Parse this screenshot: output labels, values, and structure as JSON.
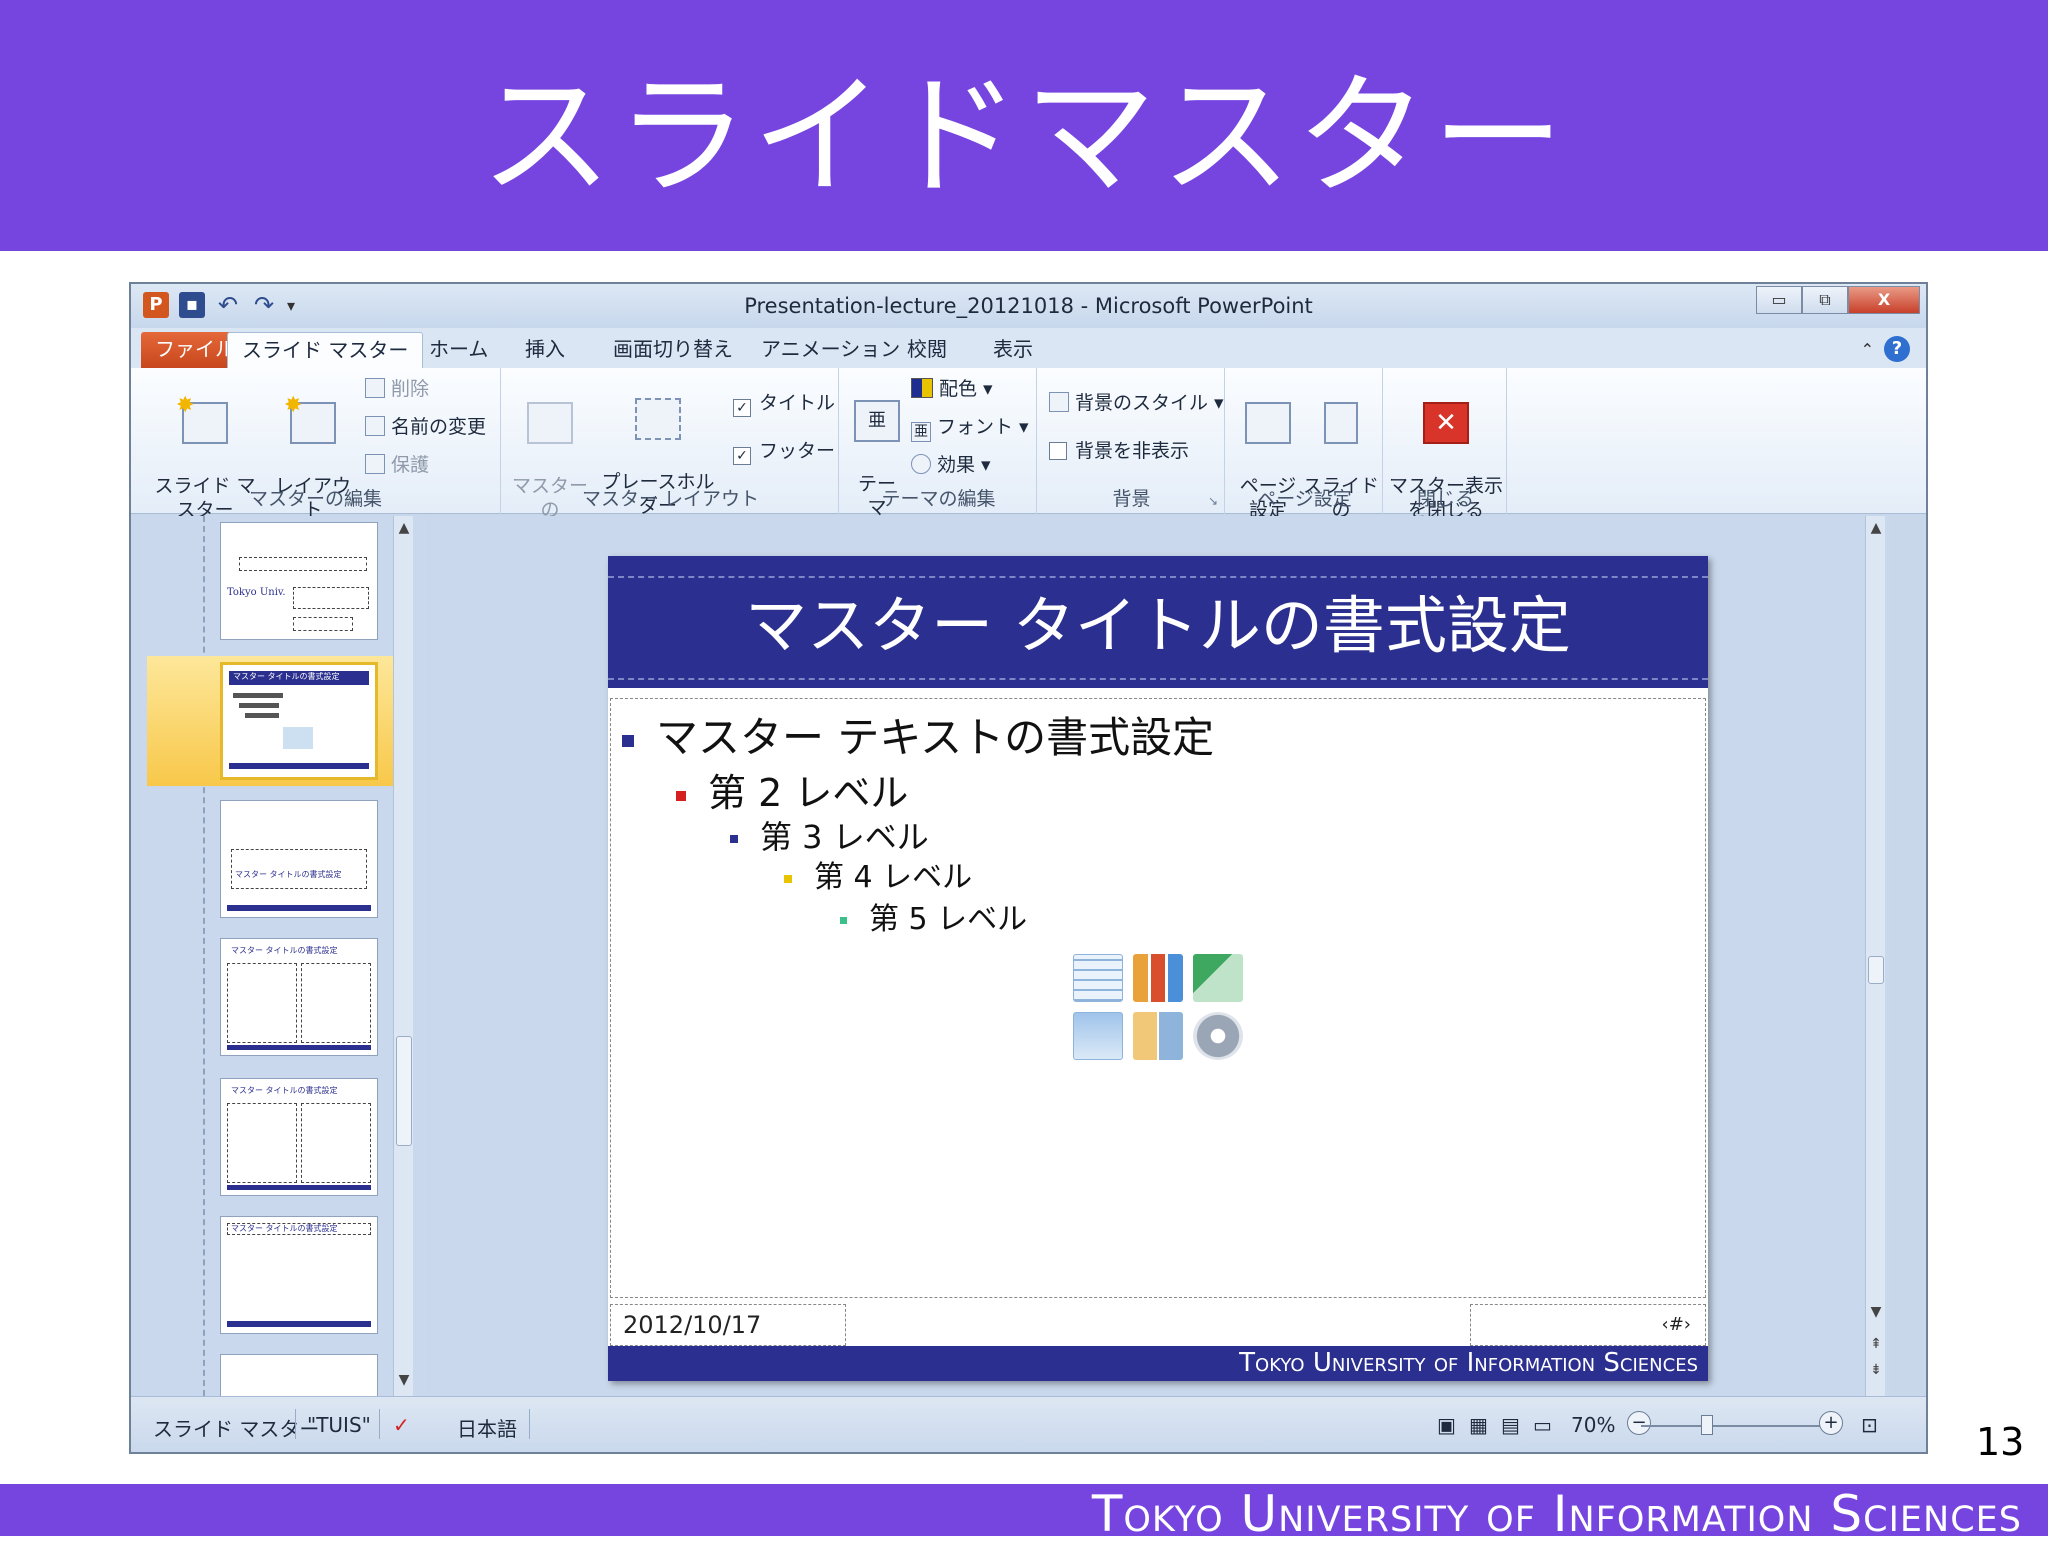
{
  "slide": {
    "title": "スライドマスター",
    "page_number": "13",
    "footer": "Tokyo University of Information Sciences"
  },
  "window": {
    "title": "Presentation-lecture_20121018 - Microsoft PowerPoint",
    "controls": {
      "minimize": "▭",
      "restore": "⧉",
      "close": "X"
    }
  },
  "ribbon": {
    "tabs": [
      "ファイル",
      "スライド マスター",
      "ホーム",
      "挿入",
      "画面切り替え",
      "アニメーション",
      "校閲",
      "表示"
    ],
    "groups": {
      "master_edit": {
        "label": "マスターの編集",
        "insert_master": "スライド マスター\nの挿入",
        "insert_layout": "レイアウト\nの挿入",
        "delete": "削除",
        "rename": "名前の変更",
        "preserve": "保護"
      },
      "master_layout": {
        "label": "マスター レイアウト",
        "master_layout_btn": "マスターの\nレイアウト",
        "insert_placeholder": "プレースホルダー\nの挿入 ▾",
        "title_chk": "タイトル",
        "footer_chk": "フッター"
      },
      "theme_edit": {
        "label": "テーマの編集",
        "theme": "テーマ\n▾",
        "colors": "配色 ▾",
        "fonts": "フォント ▾",
        "effects": "効果 ▾"
      },
      "background": {
        "label": "背景",
        "styles": "背景のスタイル ▾",
        "hide": "背景を非表示"
      },
      "page_setup": {
        "label": "ページ設定",
        "setup": "ページ\n設定",
        "orientation": "スライドの\n向き ▾"
      },
      "close": {
        "label": "閉じる",
        "close_master": "マスター表示\nを閉じる"
      }
    }
  },
  "master_slide": {
    "title": "マスター タイトルの書式設定",
    "levels": [
      "マスター テキストの書式設定",
      "第 2 レベル",
      "第 3 レベル",
      "第 4 レベル",
      "第 5 レベル"
    ],
    "date": "2012/10/17",
    "number": "‹#›",
    "footer": "Tokyo University of Information Sciences"
  },
  "thumbnails": {
    "thumb1_text": "Tokyo Univ.",
    "thumb2_title": "マスター タイトルの書式設定",
    "thumb3_title": "マスター タイトルの書式設定",
    "thumb4_title": "マスター タイトルの書式設定",
    "thumb5_title": "マスター タイトルの書式設定",
    "thumb6_title": "マスター タイトルの書式設定"
  },
  "statusbar": {
    "view": "スライド マスター",
    "theme": "\"TUIS\"",
    "language": "日本語",
    "zoom": "70%"
  },
  "colors": {
    "slide_band": "#7645e0",
    "master_band": "#2b2f8f",
    "bullet_l1": "#2b2f8f",
    "bullet_l2": "#d42020",
    "bullet_l3": "#2b2f8f",
    "bullet_l4": "#e8c400",
    "bullet_l5": "#3cc08a"
  }
}
